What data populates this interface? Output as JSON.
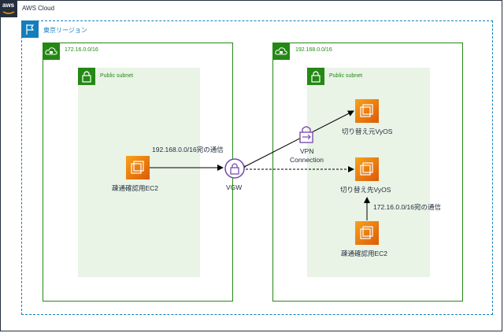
{
  "aws_cloud": {
    "title": "AWS Cloud",
    "logo_text": "aws"
  },
  "region": {
    "title": "東京リージョン"
  },
  "vpc_left": {
    "cidr": "172.16.0.0/16",
    "subnet": {
      "title": "Public subnet"
    },
    "ec2": {
      "label": "疎通確認用EC2"
    }
  },
  "vpc_right": {
    "cidr": "192.168.0.0/16",
    "subnet": {
      "title": "Public subnet"
    },
    "vyos_source": {
      "label": "切り替え元VyOS"
    },
    "vyos_target": {
      "label": "切り替え先VyOS"
    },
    "ec2": {
      "label": "疎通確認用EC2"
    }
  },
  "vgw": {
    "label": "VGW"
  },
  "vpn": {
    "label_line1": "VPN",
    "label_line2": "Connection"
  },
  "route_to_right": {
    "label": "192.168.0.0/16宛の通信"
  },
  "route_to_left": {
    "label": "172.16.0.0/16宛の通信"
  },
  "colors": {
    "aws_dark": "#232f3e",
    "region_blue": "#147eba",
    "vpc_green": "#248814",
    "subnet_fill": "#e9f3e6",
    "ec2_orange": "#dd5a06",
    "vgw_purple": "#7b4fb0"
  }
}
